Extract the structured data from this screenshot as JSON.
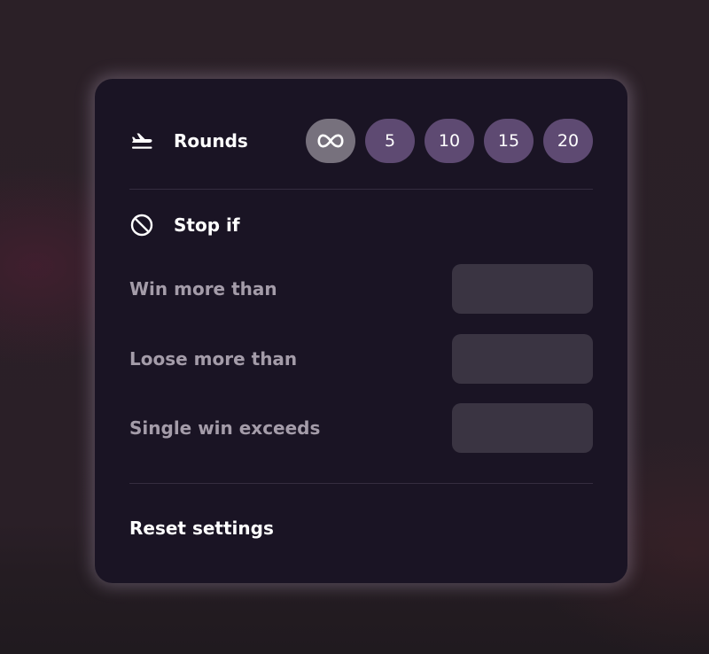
{
  "rounds": {
    "label": "Rounds",
    "icon": "airplane-takeoff-icon",
    "options": [
      {
        "label": "∞",
        "icon": "infinity-icon",
        "selected": true
      },
      {
        "label": "5",
        "selected": false
      },
      {
        "label": "10",
        "selected": false
      },
      {
        "label": "15",
        "selected": false
      },
      {
        "label": "20",
        "selected": false
      }
    ]
  },
  "stop_if": {
    "label": "Stop if",
    "icon": "prohibited-icon",
    "conditions": [
      {
        "label": "Win more than",
        "value": ""
      },
      {
        "label": "Loose more than",
        "value": ""
      },
      {
        "label": "Single win exceeds",
        "value": ""
      }
    ]
  },
  "reset": {
    "label": "Reset settings"
  },
  "colors": {
    "panel_bg": "#1a1424",
    "round_button": "#5e4a72",
    "round_button_selected": "#77717d",
    "input_bg": "#3a3442",
    "muted_text": "#a49ca9"
  }
}
